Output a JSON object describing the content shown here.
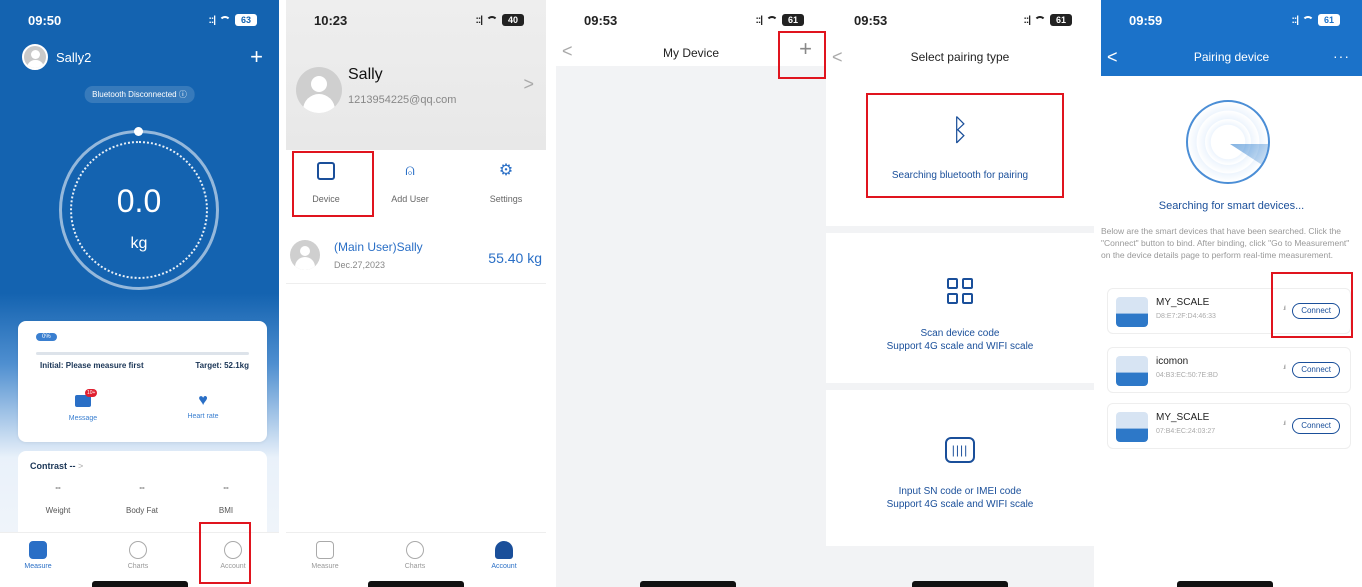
{
  "screen1": {
    "time": "09:50",
    "battery": "63",
    "user_name": "Sally2",
    "add_symbol": "+",
    "bt_status": "Bluetooth Disconnected ⓘ",
    "weight_value": "0.0",
    "weight_unit": "kg",
    "progress_label": "0%",
    "progress": 0,
    "initial_text": "Initial: Please measure first",
    "target_text": "Target: 52.1kg",
    "message_label": "Message",
    "message_badge": "10+",
    "heart_label": "Heart rate",
    "contrast_label": "Contrast --",
    "contrast_arrow": ">",
    "metrics": [
      {
        "value": "--",
        "label": "Weight"
      },
      {
        "value": "--",
        "label": "Body Fat"
      },
      {
        "value": "--",
        "label": "BMI"
      }
    ],
    "tabs": [
      {
        "label": "Measure",
        "icon": "scale-icon"
      },
      {
        "label": "Charts",
        "icon": "chart-icon"
      },
      {
        "label": "Account",
        "icon": "person-icon"
      }
    ]
  },
  "screen2": {
    "time": "10:23",
    "battery": "40",
    "user_name": "Sally",
    "email": "1213954225@qq.com",
    "chevron": ">",
    "quick_tabs": [
      {
        "label": "Device",
        "icon": "device-icon"
      },
      {
        "label": "Add User",
        "icon": "add-user-icon"
      },
      {
        "label": "Settings",
        "icon": "gear-icon"
      }
    ],
    "user_row": {
      "name": "(Main User)Sally",
      "date": "Dec.27,2023",
      "weight": "55.40 kg"
    },
    "tabs": [
      {
        "label": "Measure"
      },
      {
        "label": "Charts"
      },
      {
        "label": "Account"
      }
    ]
  },
  "screen3": {
    "time": "09:53",
    "battery": "61",
    "title": "My Device",
    "back": "<",
    "plus": "+"
  },
  "screen4": {
    "time": "09:53",
    "battery": "61",
    "back": "<",
    "title": "Select pairing type",
    "options": [
      {
        "line1": "Searching bluetooth for pairing",
        "line2": "",
        "icon": "bluetooth-icon"
      },
      {
        "line1": "Scan device code",
        "line2": "Support 4G scale and WIFI scale",
        "icon": "qr-code-icon"
      },
      {
        "line1": "Input SN code or IMEI code",
        "line2": "Support 4G scale and WIFI scale",
        "icon": "barcode-icon"
      }
    ]
  },
  "screen5": {
    "time": "09:59",
    "battery": "61",
    "back": "<",
    "title": "Pairing device",
    "more": "···",
    "searching": "Searching for smart devices...",
    "description": "Below are the smart devices that have been searched. Click the \"Connect\" button to bind. After binding, click \"Go to Measurement\" on the device details page to perform real-time measurement.",
    "devices": [
      {
        "name": "MY_SCALE",
        "mac": "D8:E7:2F:D4:46:33",
        "signal": ".ıl",
        "button": "Connect"
      },
      {
        "name": "icomon",
        "mac": "04:B3:EC:50:7E:BD",
        "signal": ".ıl",
        "button": "Connect"
      },
      {
        "name": "MY_SCALE",
        "mac": "07:B4:EC:24:03:27",
        "signal": ".ıl",
        "button": "Connect"
      }
    ]
  },
  "colors": {
    "brand_blue": "#1463b0",
    "accent": "#2a6fc6",
    "highlight_box": "#e0141e"
  }
}
